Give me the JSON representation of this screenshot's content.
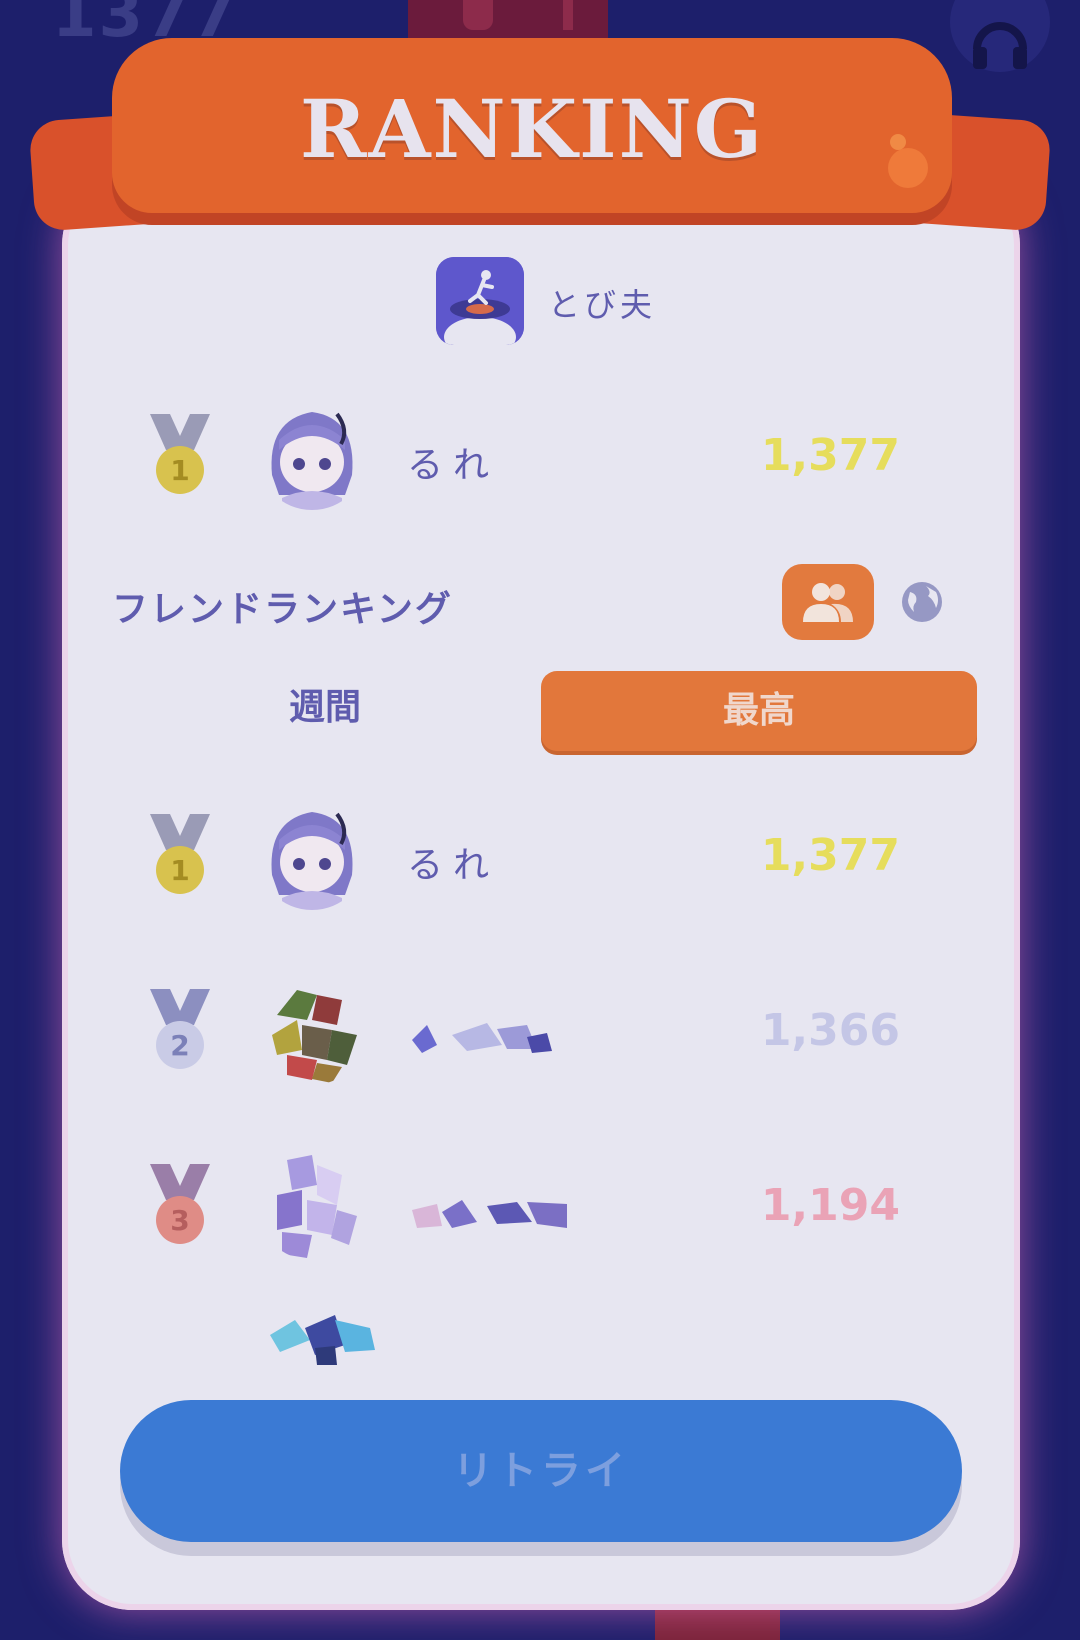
{
  "background": {
    "score": "1377"
  },
  "header": {
    "title": "RANKING"
  },
  "game": {
    "name": "とび夫",
    "icon": "jumper-app-icon"
  },
  "my_rank": {
    "rank": "1",
    "name": "るれ",
    "score": "1,377"
  },
  "friend_ranking": {
    "title": "フレンドランキング",
    "friends_icon": "people-icon",
    "global_icon": "globe-icon"
  },
  "tabs": [
    {
      "label": "週間",
      "active": false
    },
    {
      "label": "最高",
      "active": true
    }
  ],
  "leaderboard": [
    {
      "rank": "1",
      "name": "るれ",
      "score": "1,377",
      "score_color": "#e6dd5c"
    },
    {
      "rank": "2",
      "name": "",
      "score": "1,366",
      "score_color": "#c4c6e6"
    },
    {
      "rank": "3",
      "name": "",
      "score": "1,194",
      "score_color": "#eaa3b6"
    }
  ],
  "retry_button": {
    "label": "リトライ"
  },
  "colors": {
    "ribbon": "#e2642d",
    "tab_active": "#e2773b",
    "retry": "#3b7ad4",
    "card": "#e7e6f1"
  }
}
